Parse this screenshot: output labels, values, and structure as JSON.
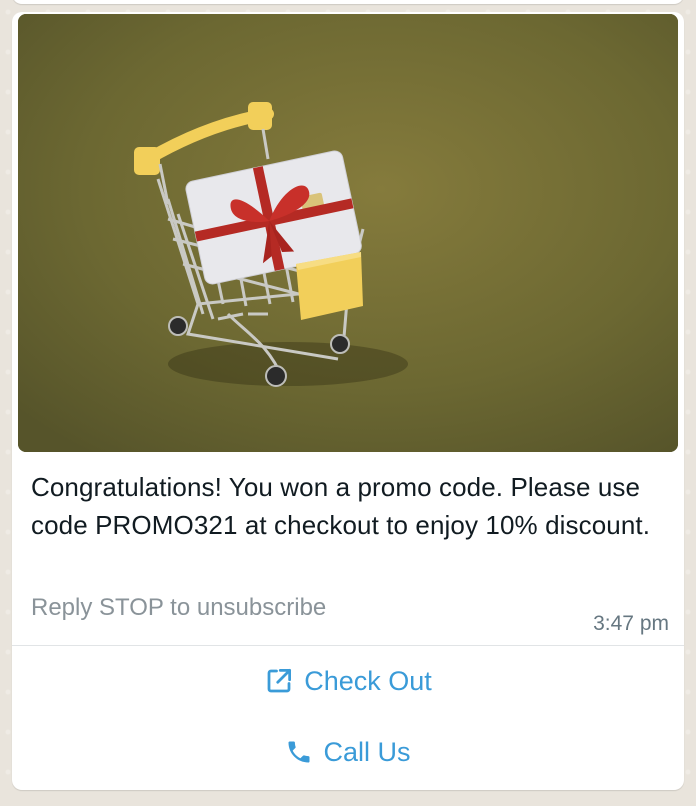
{
  "message": {
    "body": "Congratulations! You won a promo code. Please use code PROMO321 at checkout to enjoy 10% discount.",
    "footer": "Reply STOP to unsubscribe",
    "time": "3:47 pm"
  },
  "actions": [
    {
      "label": "Check Out",
      "icon": "external-link-icon"
    },
    {
      "label": "Call Us",
      "icon": "phone-icon"
    }
  ],
  "colors": {
    "accent": "#3a9bd8",
    "image_background": "#6e6a33"
  }
}
